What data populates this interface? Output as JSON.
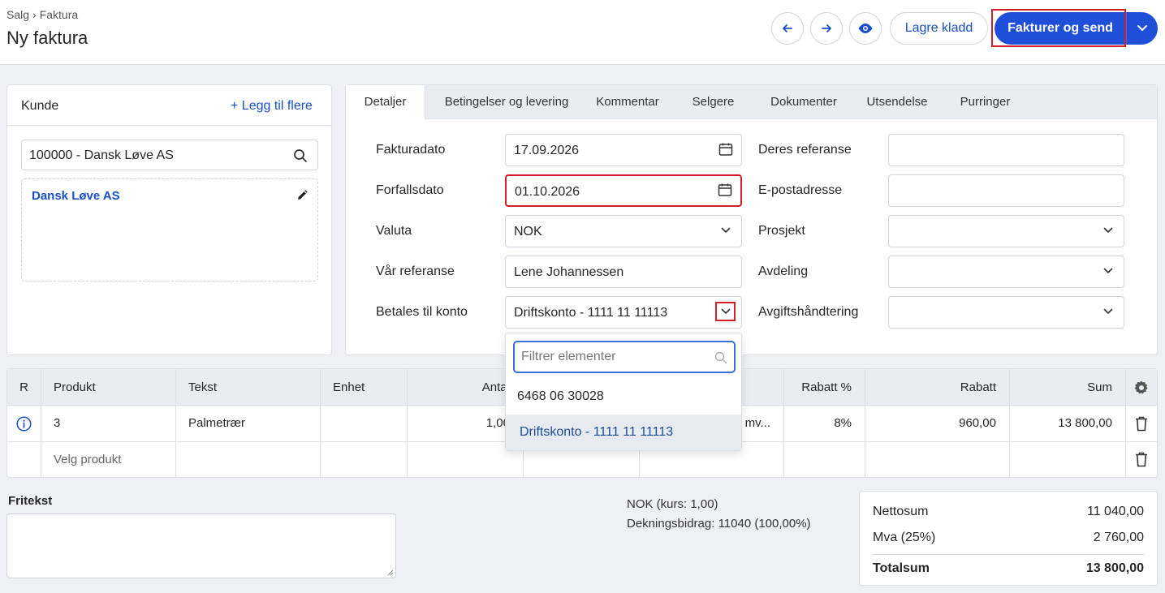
{
  "header": {
    "breadcrumb": [
      "Salg",
      "Faktura"
    ],
    "breadcrumb_sep": "›",
    "title": "Ny faktura",
    "save_draft": "Lagre kladd",
    "invoice_send": "Fakturer og send"
  },
  "customer": {
    "title": "Kunde",
    "add_more": "+ Legg til flere",
    "search_value": "100000 - Dansk Løve AS",
    "selected_name": "Dansk Løve AS"
  },
  "tabs": [
    "Detaljer",
    "Betingelser og levering",
    "Kommentar",
    "Selgere",
    "Dokumenter",
    "Utsendelse",
    "Purringer"
  ],
  "fields": {
    "invoice_date": {
      "label": "Fakturadato",
      "value": "17.09.2026"
    },
    "due_date": {
      "label": "Forfallsdato",
      "value": "01.10.2026"
    },
    "currency": {
      "label": "Valuta",
      "value": "NOK"
    },
    "our_ref": {
      "label": "Vår referanse",
      "value": "Lene Johannessen"
    },
    "pay_to": {
      "label": "Betales til konto",
      "value": "Driftskonto - 1111 11 11113"
    },
    "their_ref": {
      "label": "Deres referanse",
      "value": ""
    },
    "email": {
      "label": "E-postadresse",
      "value": ""
    },
    "project": {
      "label": "Prosjekt",
      "value": ""
    },
    "department": {
      "label": "Avdeling",
      "value": ""
    },
    "vat_handling": {
      "label": "Avgiftshåndtering",
      "value": ""
    }
  },
  "dropdown": {
    "filter_placeholder": "Filtrer elementer",
    "options": [
      "6468 06 30028",
      "Driftskonto - 1111 11 11113"
    ]
  },
  "table": {
    "headers": {
      "r": "R",
      "product": "Produkt",
      "text": "Tekst",
      "unit": "Enhet",
      "qty": "Antal",
      "discount_pct": "Rabatt %",
      "discount": "Rabatt",
      "sum": "Sum"
    },
    "row1": {
      "product": "3",
      "text": "Palmetrær",
      "qty": "1,00",
      "vat": "mv...",
      "discount_pct": "8%",
      "discount": "960,00",
      "sum": "13 800,00"
    },
    "add_product": "Velg produkt"
  },
  "footer": {
    "free_text_label": "Fritekst",
    "exchange": "NOK (kurs: 1,00)",
    "margin": "Dekningsbidrag: 11040 (100,00%)",
    "net_label": "Nettosum",
    "net_value": "11 040,00",
    "vat_label": "Mva (25%)",
    "vat_value": "2 760,00",
    "total_label": "Totalsum",
    "total_value": "13 800,00"
  }
}
